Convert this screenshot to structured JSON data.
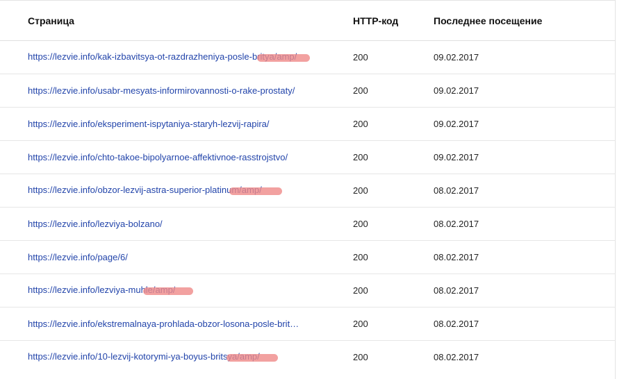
{
  "table": {
    "headers": {
      "page": "Страница",
      "code": "HTTP-код",
      "date": "Последнее посещение"
    },
    "rows": [
      {
        "url": "https://lezvie.info/kak-izbavitsya-ot-razdrazheniya-posle-britya/amp/",
        "code": "200",
        "date": "09.02.2017"
      },
      {
        "url": "https://lezvie.info/usabr-mesyats-informirovannosti-o-rake-prostaty/",
        "code": "200",
        "date": "09.02.2017"
      },
      {
        "url": "https://lezvie.info/eksperiment-ispytaniya-staryh-lezvij-rapira/",
        "code": "200",
        "date": "09.02.2017"
      },
      {
        "url": "https://lezvie.info/chto-takoe-bipolyarnoe-affektivnoe-rasstrojstvo/",
        "code": "200",
        "date": "09.02.2017"
      },
      {
        "url": "https://lezvie.info/obzor-lezvij-astra-superior-platinum/amp/",
        "code": "200",
        "date": "08.02.2017"
      },
      {
        "url": "https://lezvie.info/lezviya-bolzano/",
        "code": "200",
        "date": "08.02.2017"
      },
      {
        "url": "https://lezvie.info/page/6/",
        "code": "200",
        "date": "08.02.2017"
      },
      {
        "url": "https://lezvie.info/lezviya-muhle/amp/",
        "code": "200",
        "date": "08.02.2017"
      },
      {
        "url": "https://lezvie.info/ekstremalnaya-prohlada-obzor-losona-posle-brit…",
        "code": "200",
        "date": "08.02.2017"
      },
      {
        "url": "https://lezvie.info/10-lezvij-kotorymi-ya-boyus-britsya/amp/",
        "code": "200",
        "date": "08.02.2017"
      }
    ]
  },
  "colors": {
    "link": "#2244aa",
    "highlight": "#ef8a88"
  }
}
